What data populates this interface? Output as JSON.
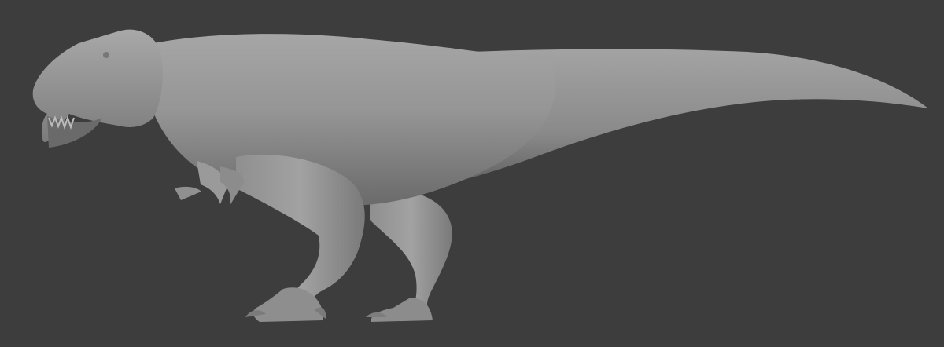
{
  "scene": {
    "background_color": "#3d3d3d",
    "model_base_color": "#8e8e8e",
    "model_highlight_color": "#a9a9a9",
    "model_shadow_color": "#5a5a5a",
    "subject_icon": "tyrannosaurus-clay-render"
  }
}
